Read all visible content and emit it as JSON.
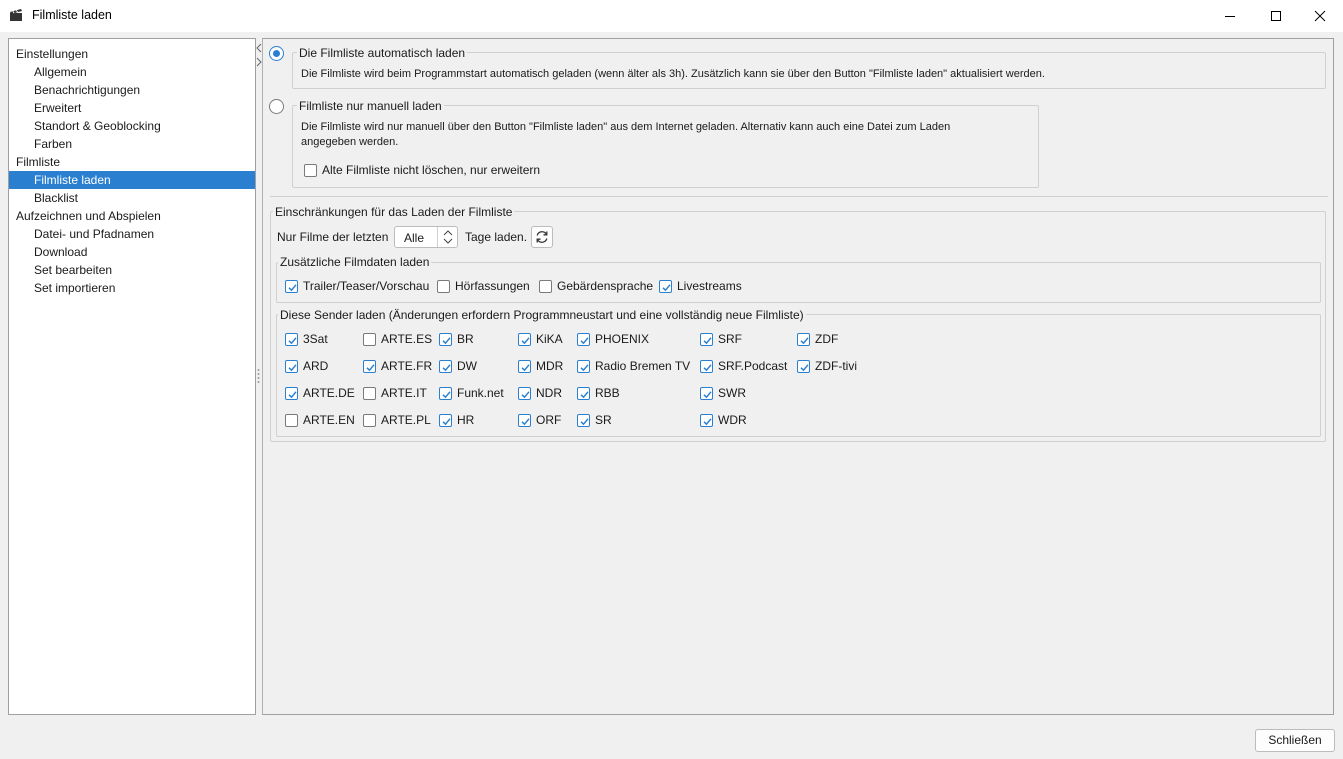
{
  "window": {
    "title": "Filmliste laden"
  },
  "nav": {
    "items": [
      {
        "label": "Einstellungen",
        "level": 0
      },
      {
        "label": "Allgemein",
        "level": 1
      },
      {
        "label": "Benachrichtigungen",
        "level": 1
      },
      {
        "label": "Erweitert",
        "level": 1
      },
      {
        "label": "Standort & Geoblocking",
        "level": 1
      },
      {
        "label": "Farben",
        "level": 1
      },
      {
        "label": "Filmliste",
        "level": 0
      },
      {
        "label": "Filmliste laden",
        "level": 1,
        "selected": true
      },
      {
        "label": "Blacklist",
        "level": 1
      },
      {
        "label": "Aufzeichnen und Abspielen",
        "level": 0
      },
      {
        "label": "Datei- und Pfadnamen",
        "level": 1
      },
      {
        "label": "Download",
        "level": 1
      },
      {
        "label": "Set bearbeiten",
        "level": 1
      },
      {
        "label": "Set importieren",
        "level": 1
      }
    ]
  },
  "load_mode": {
    "auto": {
      "label": "Die Filmliste automatisch laden",
      "selected": true,
      "description": "Die Filmliste wird beim Programmstart automatisch geladen (wenn älter als 3h). Zusätzlich kann sie über den Button \"Filmliste laden\" aktualisiert werden."
    },
    "manual": {
      "label": "Filmliste nur manuell laden",
      "selected": false,
      "description_line1": "Die Filmliste wird nur manuell über den Button \"Filmliste laden\" aus dem Internet geladen. Alternativ kann auch eine Datei zum Laden",
      "description_line2": "angegeben werden.",
      "keep_old": {
        "label": "Alte Filmliste nicht löschen, nur erweitern",
        "checked": false
      }
    }
  },
  "restrictions": {
    "title": "Einschränkungen für das Laden der Filmliste",
    "days_prefix": "Nur Filme der letzten",
    "days_value": "Alle",
    "days_suffix": "Tage laden.",
    "reload_icon": "refresh-icon",
    "extra": {
      "title": "Zusätzliche Filmdaten laden",
      "options": [
        {
          "label": "Trailer/Teaser/Vorschau",
          "checked": true
        },
        {
          "label": "Hörfassungen",
          "checked": false
        },
        {
          "label": "Gebärdensprache",
          "checked": false
        },
        {
          "label": "Livestreams",
          "checked": true
        }
      ]
    },
    "senders": {
      "title": "Diese Sender laden (Änderungen erfordern Programmneustart und eine vollständig neue Filmliste)",
      "columns": [
        [
          {
            "label": "3Sat",
            "checked": true
          },
          {
            "label": "ARD",
            "checked": true
          },
          {
            "label": "ARTE.DE",
            "checked": true
          },
          {
            "label": "ARTE.EN",
            "checked": false
          }
        ],
        [
          {
            "label": "ARTE.ES",
            "checked": false
          },
          {
            "label": "ARTE.FR",
            "checked": true
          },
          {
            "label": "ARTE.IT",
            "checked": false
          },
          {
            "label": "ARTE.PL",
            "checked": false
          }
        ],
        [
          {
            "label": "BR",
            "checked": true
          },
          {
            "label": "DW",
            "checked": true
          },
          {
            "label": "Funk.net",
            "checked": true
          },
          {
            "label": "HR",
            "checked": true
          }
        ],
        [
          {
            "label": "KiKA",
            "checked": true
          },
          {
            "label": "MDR",
            "checked": true
          },
          {
            "label": "NDR",
            "checked": true
          },
          {
            "label": "ORF",
            "checked": true
          }
        ],
        [
          {
            "label": "PHOENIX",
            "checked": true
          },
          {
            "label": "Radio Bremen TV",
            "checked": true
          },
          {
            "label": "RBB",
            "checked": true
          },
          {
            "label": "SR",
            "checked": true
          }
        ],
        [
          {
            "label": "SRF",
            "checked": true
          },
          {
            "label": "SRF.Podcast",
            "checked": true
          },
          {
            "label": "SWR",
            "checked": true
          },
          {
            "label": "WDR",
            "checked": true
          }
        ],
        [
          {
            "label": "ZDF",
            "checked": true
          },
          {
            "label": "ZDF-tivi",
            "checked": true
          }
        ]
      ]
    }
  },
  "footer": {
    "close_label": "Schließen"
  },
  "colors": {
    "accent": "#2a7fd1",
    "selection": "#2a7fd1"
  }
}
